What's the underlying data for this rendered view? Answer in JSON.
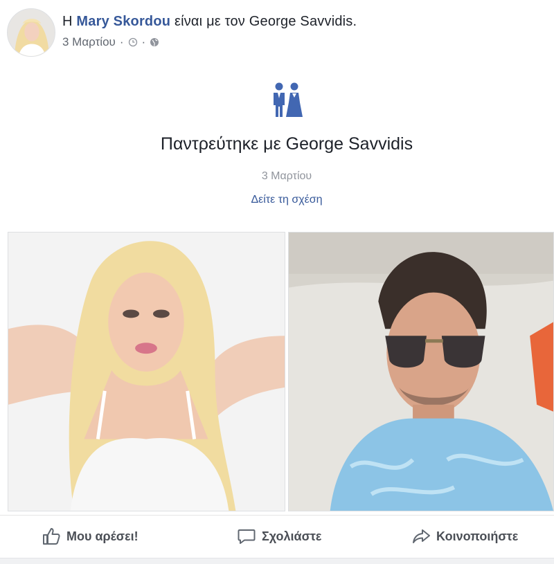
{
  "post": {
    "prefix": "Η",
    "author": "Mary Skordou",
    "with_text": "είναι με τον George Savvidis.",
    "date": "3 Μαρτίου",
    "separator": "·",
    "icons": {
      "audience": "clock-icon",
      "privacy": "globe-icon"
    }
  },
  "life_event": {
    "icon": "wedding-couple-icon",
    "title": "Παντρεύτηκε με George Savvidis",
    "date": "3 Μαρτίου",
    "link": "Δείτε τη σχέση"
  },
  "photos": [
    {
      "name": "photo-left",
      "subject": "woman-portrait"
    },
    {
      "name": "photo-right",
      "subject": "man-sunglasses-portrait"
    }
  ],
  "actions": {
    "like": "Μου αρέσει!",
    "comment": "Σχολιάστε",
    "share": "Κοινοποιήστε"
  },
  "colors": {
    "link": "#365899",
    "text": "#1d2129",
    "muted": "#90949c",
    "action": "#4b4f56"
  }
}
